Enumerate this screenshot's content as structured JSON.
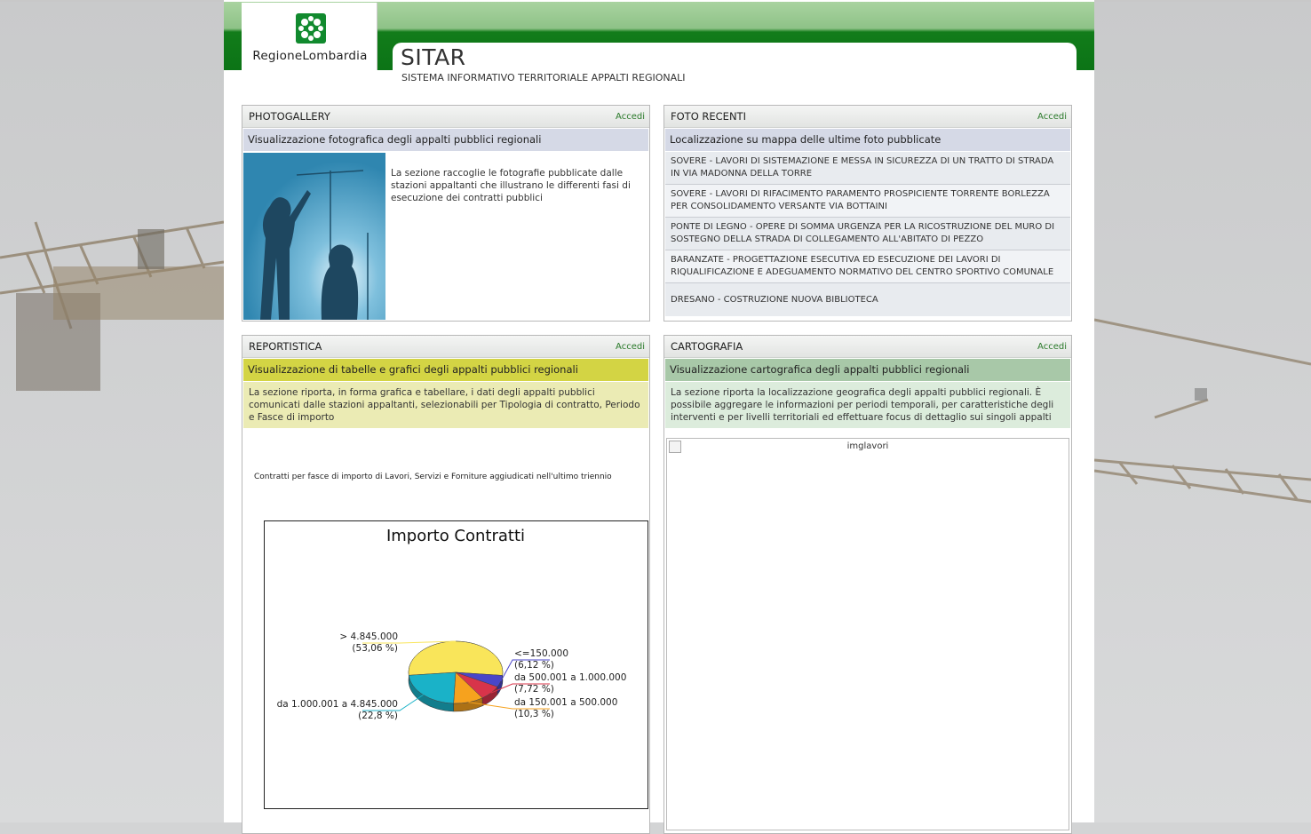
{
  "header": {
    "logo_text": "RegioneLombardia",
    "app_title": "SITAR",
    "app_subtitle": "SISTEMA INFORMATIVO TERRITORIALE APPALTI REGIONALI"
  },
  "panels": {
    "photogallery": {
      "title": "PHOTOGALLERY",
      "link": "Accedi",
      "subtitle": "Visualizzazione fotografica degli appalti pubblici regionali",
      "description": "La sezione raccoglie le fotografie pubblicate dalle stazioni appaltanti che illustrano le differenti fasi di esecuzione dei contratti pubblici"
    },
    "foto_recenti": {
      "title": "FOTO RECENTI",
      "link": "Accedi",
      "subtitle": "Localizzazione su mappa delle ultime foto pubblicate",
      "items": [
        "SOVERE - LAVORI DI SISTEMAZIONE E MESSA IN SICUREZZA DI UN TRATTO DI STRADA IN VIA MADONNA DELLA TORRE",
        "SOVERE - LAVORI DI RIFACIMENTO PARAMENTO PROSPICIENTE TORRENTE BORLEZZA PER CONSOLIDAMENTO VERSANTE VIA BOTTAINI",
        "PONTE DI LEGNO - OPERE DI SOMMA URGENZA PER LA RICOSTRUZIONE DEL MURO DI SOSTEGNO DELLA STRADA DI COLLEGAMENTO ALL'ABITATO DI PEZZO",
        "BARANZATE - PROGETTAZIONE ESECUTIVA ED ESECUZIONE DEI LAVORI DI RIQUALIFICAZIONE E ADEGUAMENTO NORMATIVO DEL CENTRO SPORTIVO COMUNALE",
        "DRESANO - COSTRUZIONE NUOVA BIBLIOTECA"
      ]
    },
    "reportistica": {
      "title": "REPORTISTICA",
      "link": "Accedi",
      "subtitle": "Visualizzazione di tabelle e grafici degli appalti pubblici regionali",
      "description": "La sezione riporta, in forma grafica e tabellare, i dati degli appalti pubblici comunicati dalle stazioni appaltanti, selezionabili per Tipologia di contratto, Periodo e Fasce di importo",
      "chart_caption": "Contratti per fasce di importo di Lavori, Servizi e Forniture aggiudicati nell'ultimo triennio"
    },
    "cartografia": {
      "title": "CARTOGRAFIA",
      "link": "Accedi",
      "subtitle": "Visualizzazione cartografica degli appalti pubblici regionali",
      "description": "La sezione riporta la localizzazione geografica degli appalti pubblici regionali. È possibile aggregare le informazioni per periodi temporali, per caratteristiche degli interventi e per livelli territoriali ed effettuare focus di dettaglio sui singoli appalti",
      "image_alt": "imglavori"
    }
  },
  "chart_data": {
    "type": "pie",
    "title": "Importo Contratti",
    "slices": [
      {
        "label": "> 4.845.000",
        "pct_label": "(53,06 %)",
        "value": 53.06,
        "color": "#f9e55a"
      },
      {
        "label": "<=150.000",
        "pct_label": "(6,12 %)",
        "value": 6.12,
        "color": "#4a46c8"
      },
      {
        "label": "da 500.001 a 1.000.000",
        "pct_label": "(7,72 %)",
        "value": 7.72,
        "color": "#d8344a"
      },
      {
        "label": "da 150.001 a 500.000",
        "pct_label": "(10,3 %)",
        "value": 10.3,
        "color": "#f6a21e"
      },
      {
        "label": "da 1.000.001 a 4.845.000",
        "pct_label": "(22,8 %)",
        "value": 22.8,
        "color": "#1ab2c8"
      }
    ]
  }
}
